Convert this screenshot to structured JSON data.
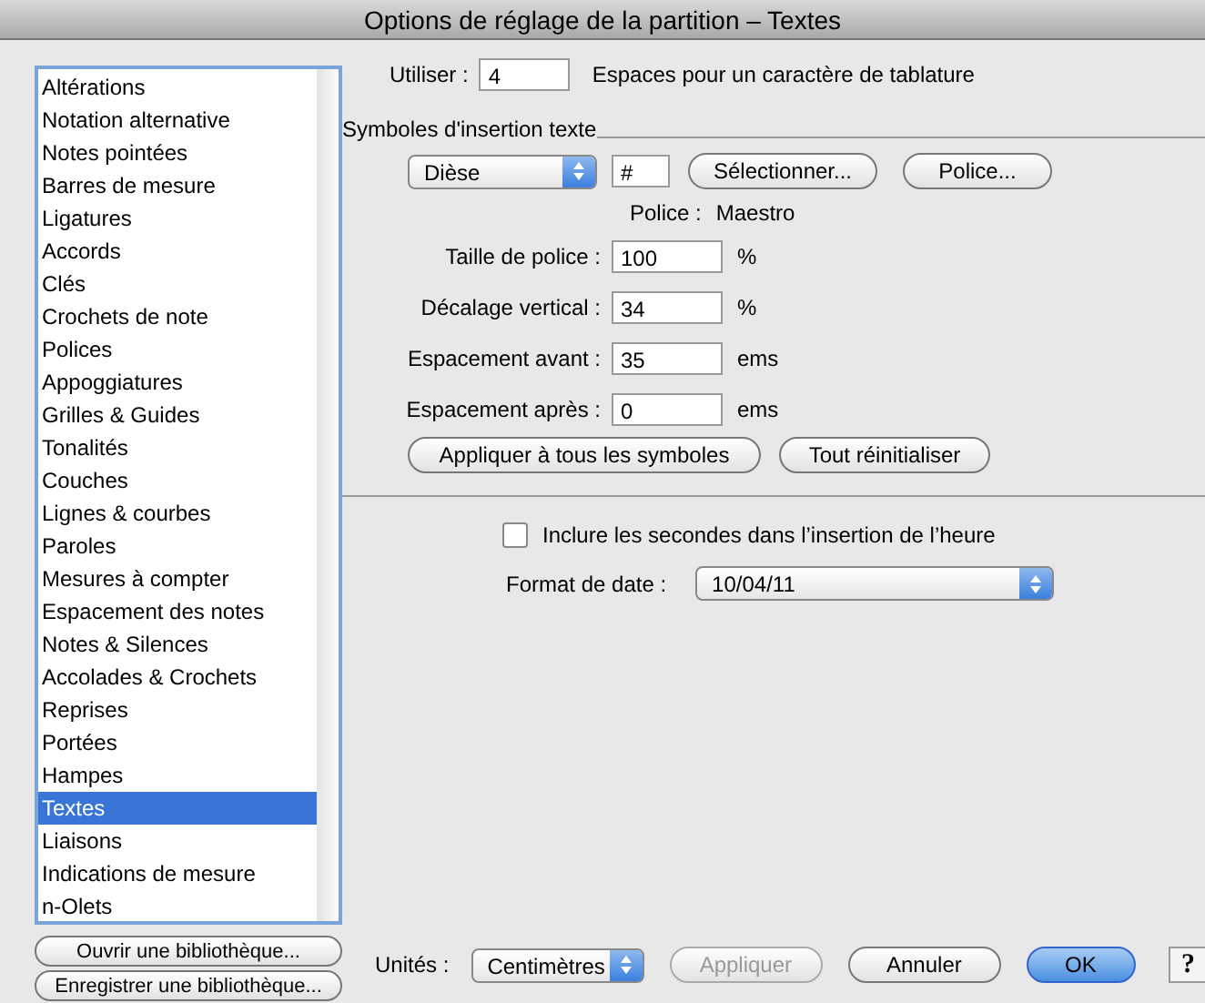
{
  "window": {
    "title": "Options de réglage de la partition – Textes"
  },
  "sidebar": {
    "items": [
      {
        "label": "Altérations",
        "selected": false
      },
      {
        "label": "Notation alternative",
        "selected": false
      },
      {
        "label": "Notes pointées",
        "selected": false
      },
      {
        "label": "Barres de mesure",
        "selected": false
      },
      {
        "label": "Ligatures",
        "selected": false
      },
      {
        "label": "Accords",
        "selected": false
      },
      {
        "label": "Clés",
        "selected": false
      },
      {
        "label": "Crochets de note",
        "selected": false
      },
      {
        "label": "Polices",
        "selected": false
      },
      {
        "label": "Appoggiatures",
        "selected": false
      },
      {
        "label": "Grilles & Guides",
        "selected": false
      },
      {
        "label": "Tonalités",
        "selected": false
      },
      {
        "label": "Couches",
        "selected": false
      },
      {
        "label": "Lignes & courbes",
        "selected": false
      },
      {
        "label": "Paroles",
        "selected": false
      },
      {
        "label": "Mesures à compter",
        "selected": false
      },
      {
        "label": "Espacement des notes",
        "selected": false
      },
      {
        "label": "Notes & Silences",
        "selected": false
      },
      {
        "label": "Accolades & Crochets",
        "selected": false
      },
      {
        "label": "Reprises",
        "selected": false
      },
      {
        "label": "Portées",
        "selected": false
      },
      {
        "label": "Hampes",
        "selected": false
      },
      {
        "label": "Textes",
        "selected": true
      },
      {
        "label": "Liaisons",
        "selected": false
      },
      {
        "label": "Indications de mesure",
        "selected": false
      },
      {
        "label": "n-Olets",
        "selected": false
      }
    ],
    "buttons": [
      "Ouvrir une bibliothèque...",
      "Enregistrer une bibliothèque..."
    ]
  },
  "tab_spaces": {
    "label": "Utiliser :",
    "value": "4",
    "suffix": "Espaces pour un caractère de tablature"
  },
  "insertion_symbols": {
    "title": "Symboles d'insertion texte",
    "symbol_popup": "Dièse",
    "symbol_value": "#",
    "select_button": "Sélectionner...",
    "font_button": "Police...",
    "font_label": "Police :",
    "font_name": "Maestro",
    "fields": [
      {
        "label": "Taille de police :",
        "value": "100",
        "unit": "%"
      },
      {
        "label": "Décalage vertical :",
        "value": "34",
        "unit": "%"
      },
      {
        "label": "Espacement avant :",
        "value": "35",
        "unit": "ems"
      },
      {
        "label": "Espacement après :",
        "value": "0",
        "unit": "ems"
      }
    ],
    "buttons": [
      "Appliquer à tous les symboles",
      "Tout réinitialiser"
    ]
  },
  "include_seconds": {
    "label": "Inclure les secondes dans l’insertion de l’heure",
    "checked": false
  },
  "date_format": {
    "label": "Format de date :",
    "value": "10/04/11"
  },
  "footer": {
    "units_label": "Unités :",
    "units_value": "Centimètres",
    "buttons": [
      {
        "label": "Appliquer",
        "kind": "disabled"
      },
      {
        "label": "Annuler",
        "kind": "normal"
      },
      {
        "label": "OK",
        "kind": "default"
      }
    ],
    "help": "?"
  }
}
